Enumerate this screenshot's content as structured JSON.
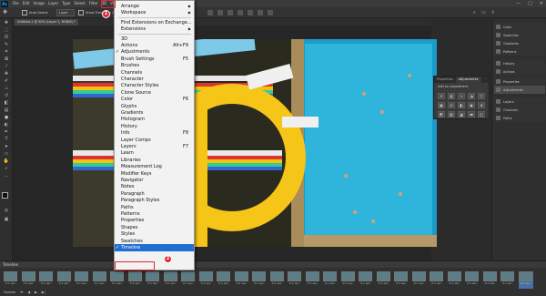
{
  "menubar": {
    "logo": "Ps",
    "items": [
      "File",
      "Edit",
      "Image",
      "Layer",
      "Type",
      "Select",
      "Filter",
      "3D",
      "View",
      "Window",
      "Help"
    ],
    "window_controls": [
      "—",
      "▢",
      "✕"
    ]
  },
  "options": {
    "auto_select": "Auto-Select:",
    "layer_select": "Layer",
    "transform": "Show Transform Controls"
  },
  "doc_tab": {
    "title": "Untitled-1 @ 50% (Layer 1, RGB/8) *"
  },
  "dock": {
    "group1": [
      "Color",
      "Swatches",
      "Gradients",
      "Patterns"
    ],
    "group2": [
      "History",
      "Actions"
    ],
    "group3": [
      "Properties",
      "Adjustments"
    ],
    "group4": [
      "Layers",
      "Channels",
      "Paths"
    ]
  },
  "adjustments_panel": {
    "tabs": [
      "Properties",
      "Adjustments"
    ],
    "hint": "Add an adjustment"
  },
  "window_menu": {
    "items": [
      {
        "label": "Arrange",
        "submenu": true
      },
      {
        "label": "Workspace",
        "submenu": true
      },
      {
        "sep": true
      },
      {
        "label": "Find Extensions on Exchange..."
      },
      {
        "label": "Extensions",
        "submenu": true
      },
      {
        "sep": true
      },
      {
        "label": "3D"
      },
      {
        "label": "Actions",
        "shortcut": "Alt+F9"
      },
      {
        "label": "Adjustments",
        "checked": true
      },
      {
        "label": "Brush Settings",
        "shortcut": "F5"
      },
      {
        "label": "Brushes"
      },
      {
        "label": "Channels"
      },
      {
        "label": "Character"
      },
      {
        "label": "Character Styles"
      },
      {
        "label": "Clone Source"
      },
      {
        "label": "Color",
        "shortcut": "F6"
      },
      {
        "label": "Glyphs"
      },
      {
        "label": "Gradients"
      },
      {
        "label": "Histogram"
      },
      {
        "label": "History"
      },
      {
        "label": "Info",
        "shortcut": "F8"
      },
      {
        "label": "Layer Comps"
      },
      {
        "label": "Layers",
        "shortcut": "F7"
      },
      {
        "label": "Learn"
      },
      {
        "label": "Libraries"
      },
      {
        "label": "Measurement Log"
      },
      {
        "label": "Modifier Keys"
      },
      {
        "label": "Navigator"
      },
      {
        "label": "Notes"
      },
      {
        "label": "Paragraph"
      },
      {
        "label": "Paragraph Styles"
      },
      {
        "label": "Paths"
      },
      {
        "label": "Patterns"
      },
      {
        "label": "Properties"
      },
      {
        "label": "Shapes"
      },
      {
        "label": "Styles"
      },
      {
        "label": "Swatches"
      },
      {
        "label": "Timeline",
        "checked": true,
        "highlighted": true
      }
    ]
  },
  "badges": {
    "one": "1",
    "two": "2"
  },
  "timeline": {
    "title": "Timeline",
    "frame_label": "0.1 sec.",
    "frame_count": 30,
    "controls": [
      "Forever",
      "⏮",
      "◀",
      "▶",
      "▶|"
    ]
  },
  "colors": {
    "highlight": "#1f6fd1",
    "callout": "#e3262f"
  }
}
